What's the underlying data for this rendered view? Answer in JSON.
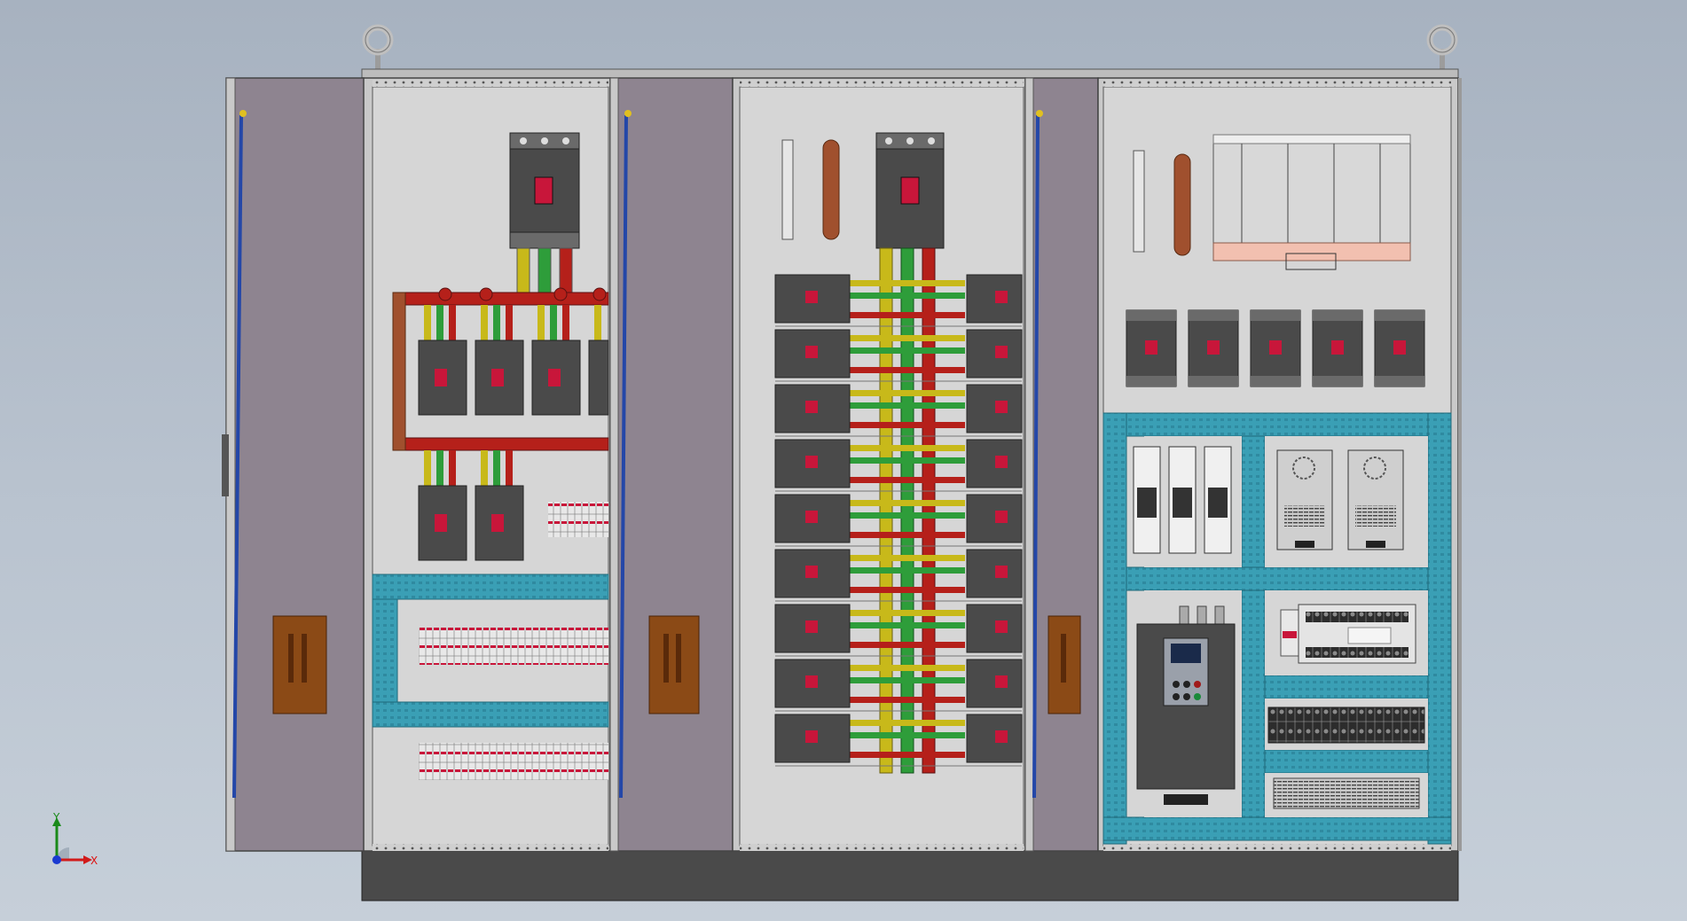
{
  "viewport": {
    "background_top": "#a7b2c0",
    "background_bottom": "#c6cfd9"
  },
  "model": {
    "cabinet_frame_color": "#c9c9c9",
    "back_panel_color": "#d6d6d6",
    "door_color": "#8e8490",
    "plinth_color": "#4a4a4a",
    "handle_color": "#8b4a16",
    "busbar_colors": {
      "phase_l1": "#c8b91a",
      "phase_l2": "#2e9d3a",
      "phase_l3": "#b5201a"
    },
    "cable_duct_color": "#3a9fb5",
    "breaker_body_color": "#4a4a4a",
    "breaker_toggle_color": "#c8163a",
    "ground_bar_color": "#a0502e",
    "lifting_eye_color": "#bfbfbf",
    "door_hinge_rod_color": "#2447a8"
  },
  "triad": {
    "x_label": "X",
    "y_label": "Y",
    "x_color": "#d11a1a",
    "y_color": "#1a8a1a",
    "z_color": "#1a3ad1"
  }
}
